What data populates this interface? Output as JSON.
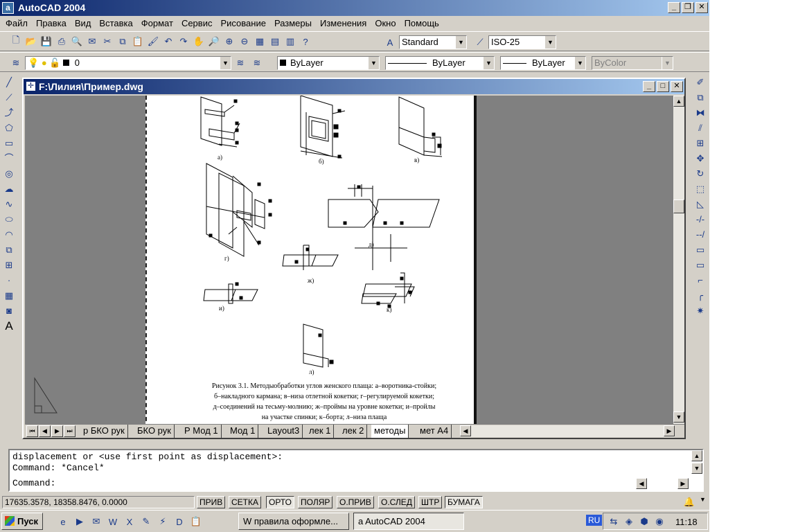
{
  "app": {
    "title": "AutoCAD 2004",
    "icon": "autocad-a-icon"
  },
  "menubar": [
    "Файл",
    "Правка",
    "Вид",
    "Вставка",
    "Формат",
    "Сервис",
    "Рисование",
    "Размеры",
    "Изменения",
    "Окно",
    "Помощь"
  ],
  "toolbar": {
    "text_style": "Standard",
    "dim_style": "ISO-25",
    "layer": "0",
    "color": "ByLayer",
    "linetype": "ByLayer",
    "lineweight": "ByLayer",
    "plotstyle": "ByColor"
  },
  "drawing_window": {
    "title": "F:\\Лилия\\Пример.dwg"
  },
  "drawing": {
    "labels": [
      "а)",
      "б)",
      "в)",
      "г)",
      "д)",
      "ж)",
      "и)",
      "к)",
      "л)"
    ],
    "caption_lines": [
      "Рисунок 3.1. Методыобработки углов женского плаща: а–воротника-стойки;",
      "б–накладного кармана; в–низа отлетной кокетки; г–регулируемой кокетки;",
      "д–соединений на тесьму-молнию; ж–проймы на уровне кокетки; и–пройлы",
      "на участке спинки; к–борта; л–низа плаща"
    ]
  },
  "layout_tabs": [
    "р БКО рук",
    "БКО рук",
    "Р Мод 1",
    "Мод 1",
    "Layout3",
    "лек 1",
    "лек 2",
    "методы",
    "мет А4"
  ],
  "active_tab": "методы",
  "command": {
    "history": [
      "displacement or <use first point as displacement>:",
      "Command: *Cancel*"
    ],
    "prompt": "Command:"
  },
  "status": {
    "coords": "17635.3578, 18358.8476, 0.0000",
    "buttons": [
      "ПРИВ",
      "СЕТКА",
      "ОРТО",
      "ПОЛЯР",
      "О.ПРИВ",
      "О.СЛЕД",
      "ШТР",
      "БУМАГА"
    ],
    "pressed": [
      "ОРТО",
      "БУМАГА"
    ]
  },
  "taskbar": {
    "start": "Пуск",
    "tasks": [
      "правила оформле...",
      "AutoCAD 2004"
    ],
    "active_task": "AutoCAD 2004",
    "lang": "RU",
    "clock": "11:18"
  }
}
